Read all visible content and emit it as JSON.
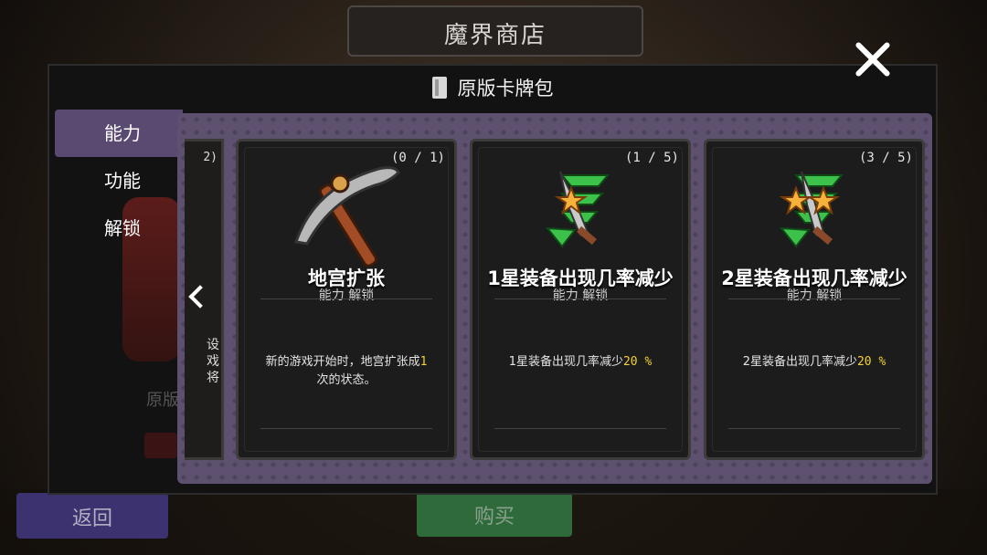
{
  "window": {
    "title": "魔界商店"
  },
  "dialog": {
    "title": "原版卡牌包"
  },
  "sidebar": {
    "items": [
      {
        "label": "能力",
        "active": true
      },
      {
        "label": "功能",
        "active": false
      },
      {
        "label": "解锁",
        "active": false
      }
    ]
  },
  "background": {
    "sprite_label": "原版"
  },
  "partial_card": {
    "count": "2)",
    "text_fragment": "设\n戏\n将"
  },
  "cards": [
    {
      "count": "(0 / 1)",
      "title": "地宫扩张",
      "subtitle": "能力 解锁",
      "desc_before": "新的游戏开始时，地宫扩张成",
      "desc_highlight": "1",
      "desc_after": "次的状态。",
      "icon": "pickaxe-icon"
    },
    {
      "count": "(1 / 5)",
      "title": "1星装备出现几率减少",
      "subtitle": "能力 解锁",
      "desc_before": "1星装备出现几率减少",
      "desc_highlight": "20 %",
      "desc_after": "",
      "icon": "one-star-sword-down-icon"
    },
    {
      "count": "(3 / 5)",
      "title": "2星装备出现几率减少",
      "subtitle": "能力 解锁",
      "desc_before": "2星装备出现几率减少",
      "desc_highlight": "20 %",
      "desc_after": "",
      "icon": "two-star-sword-down-icon"
    }
  ],
  "buttons": {
    "back": "返回",
    "buy": "购买"
  },
  "colors": {
    "panel": "#5e5170",
    "highlight": "#f2d231",
    "back": "#3d3270",
    "buy": "#2e6a3a"
  }
}
